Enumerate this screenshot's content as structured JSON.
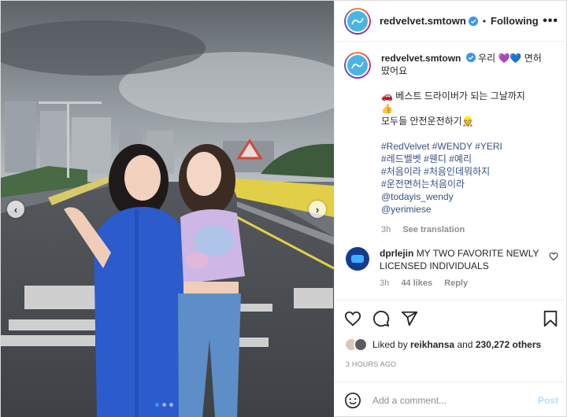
{
  "post": {
    "username": "redvelvet.smtown",
    "follow_label": "Following",
    "more_label": "•••",
    "separator": "•",
    "photo": {
      "alt": "",
      "road_text_1": "",
      "road_text_2": ""
    },
    "caption": {
      "line1": "우리 💜💙 면허",
      "line2": "땄어요",
      "line3": "🚗 베스트 드라이버가 되는 그날까지",
      "line4": "👍",
      "line5": "모두들 안전운전하기👷",
      "tags_1": "#RedVelvet #WENDY #YERI",
      "tags_2": "#레드벨벳 #웬디 #예리",
      "tags_3": "#처음이라 #처음인데뭐하지",
      "tags_4": "#운전면허는처음이라",
      "mention_1": "@todayis_wendy",
      "mention_2": "@yerimiese",
      "time": "3h",
      "translate": "See translation"
    },
    "comment": {
      "username": "dprlejin",
      "text": "MY TWO FAVORITE NEWLY LICENSED INDIVIDUALS",
      "time": "3h",
      "likes": "44 likes",
      "reply": "Reply"
    },
    "likes": {
      "prefix": "Liked by",
      "user": "reikhansa",
      "conjunction": "and",
      "others": "230,272 others"
    },
    "date": "3 HOURS AGO",
    "add_comment": {
      "placeholder": "Add a comment...",
      "post_label": "Post"
    },
    "icons": [
      "heart-icon",
      "comment-icon",
      "share-icon",
      "bookmark-icon",
      "emoji-icon",
      "verified-icon"
    ],
    "colors": {
      "link": "#385185",
      "meta": "#8e8e8e",
      "post_button": "#b2dffc",
      "verified": "#3897f0",
      "active_dot": "#3897f0"
    },
    "carousel": {
      "current": 1,
      "total": 3
    }
  }
}
